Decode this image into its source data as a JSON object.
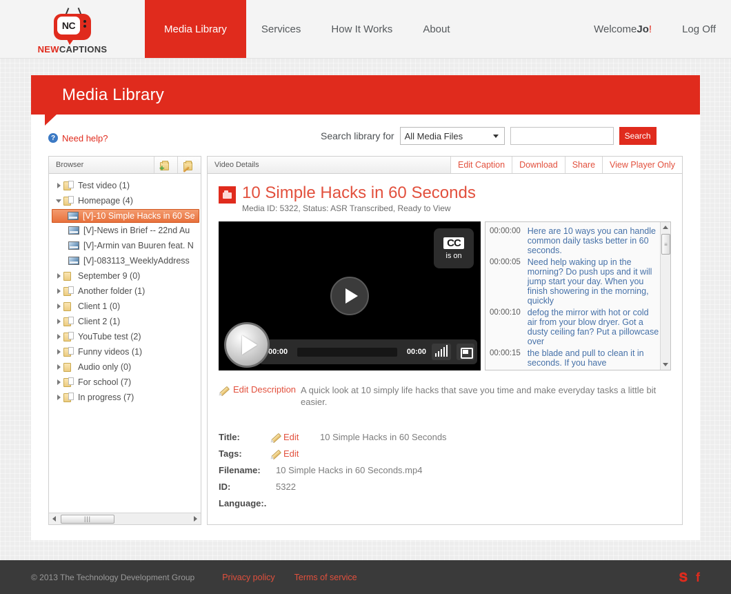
{
  "nav": {
    "logo": {
      "mark": "NC",
      "word_new": "NEW",
      "word_captions": "CAPTIONS"
    },
    "items": [
      {
        "label": "Media Library",
        "active": true
      },
      {
        "label": "Services",
        "active": false
      },
      {
        "label": "How It Works",
        "active": false
      },
      {
        "label": "About",
        "active": false
      }
    ],
    "welcome_prefix": "Welcome ",
    "welcome_user": "Jo",
    "welcome_suffix": "!",
    "logoff": "Log Off"
  },
  "banner": {
    "title": "Media Library"
  },
  "help": {
    "label": "Need help?",
    "icon": "?"
  },
  "search": {
    "label": "Search library for",
    "selected_option": "All Media Files",
    "input_value": "",
    "placeholder": "",
    "button": "Search"
  },
  "browser": {
    "title": "Browser",
    "tools": [
      {
        "name": "add-folder-icon"
      },
      {
        "name": "edit-folder-icon"
      }
    ],
    "tree": [
      {
        "label": "Test video (1)",
        "depth": 0,
        "type": "folder",
        "has_doc": true,
        "expanded": false,
        "selected": false
      },
      {
        "label": "Homepage (4)",
        "depth": 0,
        "type": "folder",
        "has_doc": true,
        "expanded": true,
        "selected": false
      },
      {
        "label": "[V]-10 Simple Hacks in 60 Se",
        "depth": 1,
        "type": "video",
        "selected": true
      },
      {
        "label": "[V]-News in Brief -- 22nd Au",
        "depth": 1,
        "type": "video",
        "selected": false
      },
      {
        "label": "[V]-Armin van Buuren feat. N",
        "depth": 1,
        "type": "video",
        "selected": false
      },
      {
        "label": "[V]-083113_WeeklyAddress",
        "depth": 1,
        "type": "video",
        "selected": false
      },
      {
        "label": "September 9 (0)",
        "depth": 0,
        "type": "folder",
        "has_doc": false,
        "expanded": false,
        "selected": false
      },
      {
        "label": "Another folder (1)",
        "depth": 0,
        "type": "folder",
        "has_doc": true,
        "expanded": false,
        "selected": false
      },
      {
        "label": "Client 1 (0)",
        "depth": 0,
        "type": "folder",
        "has_doc": false,
        "expanded": false,
        "selected": false
      },
      {
        "label": "Client 2 (1)",
        "depth": 0,
        "type": "folder",
        "has_doc": true,
        "expanded": false,
        "selected": false
      },
      {
        "label": "YouTube test (2)",
        "depth": 0,
        "type": "folder",
        "has_doc": true,
        "expanded": false,
        "selected": false
      },
      {
        "label": "Funny videos (1)",
        "depth": 0,
        "type": "folder",
        "has_doc": true,
        "expanded": false,
        "selected": false
      },
      {
        "label": "Audio only (0)",
        "depth": 0,
        "type": "folder",
        "has_doc": false,
        "expanded": false,
        "selected": false
      },
      {
        "label": "For school (7)",
        "depth": 0,
        "type": "folder",
        "has_doc": true,
        "expanded": false,
        "selected": false
      },
      {
        "label": "In progress (7)",
        "depth": 0,
        "type": "folder",
        "has_doc": true,
        "expanded": false,
        "selected": false
      }
    ],
    "hscroll_grip": "|||"
  },
  "details": {
    "title": "Video Details",
    "tabs": [
      {
        "label": "Edit Caption"
      },
      {
        "label": "Download"
      },
      {
        "label": "Share"
      },
      {
        "label": "View Player Only"
      }
    ],
    "media_title": "10 Simple Hacks in 60 Seconds",
    "media_sub": "Media ID: 5322, Status: ASR Transcribed, Ready to View",
    "player": {
      "cc_badge": "CC",
      "cc_state": "is on",
      "time_current": "00:00",
      "time_total": "00:00"
    },
    "transcript": [
      {
        "time": "00:00:00",
        "text": "Here are 10 ways you can handle common daily tasks better in 60 seconds."
      },
      {
        "time": "00:00:05",
        "text": "Need help waking up in the morning? Do push ups and it will jump start your day. When you finish showering in the morning, quickly"
      },
      {
        "time": "00:00:10",
        "text": "defog the mirror with hot or cold air from your blow dryer. Got a dusty ceiling fan? Put a pillowcase over"
      },
      {
        "time": "00:00:15",
        "text": "the blade and pull to clean it in seconds. If you have"
      }
    ],
    "description": {
      "edit_label": "Edit Description",
      "text": "A quick look at 10 simply life hacks that save you time and make everyday tasks a little bit easier."
    },
    "meta": [
      {
        "key": "Title:",
        "edit": "Edit",
        "value": "10 Simple Hacks in 60 Seconds"
      },
      {
        "key": "Tags:",
        "edit": "Edit",
        "value": ""
      },
      {
        "key": "Filename:",
        "edit": "",
        "value": "10 Simple Hacks in 60 Seconds.mp4"
      },
      {
        "key": "ID:",
        "edit": "",
        "value": "5322"
      },
      {
        "key": "Language:.",
        "edit": "",
        "value": ""
      }
    ]
  },
  "footer": {
    "copyright": "© 2013 The Technology Development Group",
    "links": [
      {
        "label": "Privacy policy"
      },
      {
        "label": "Terms of service"
      }
    ],
    "socials": [
      {
        "name": "twitter-icon",
        "glyph": "𝕏"
      },
      {
        "name": "facebook-icon",
        "glyph": "f"
      }
    ]
  },
  "colors": {
    "brand_red": "#e02b1d",
    "link_red": "#e2503d",
    "footer_bg": "#3a3a3a",
    "selection_orange": "#e8713c"
  }
}
